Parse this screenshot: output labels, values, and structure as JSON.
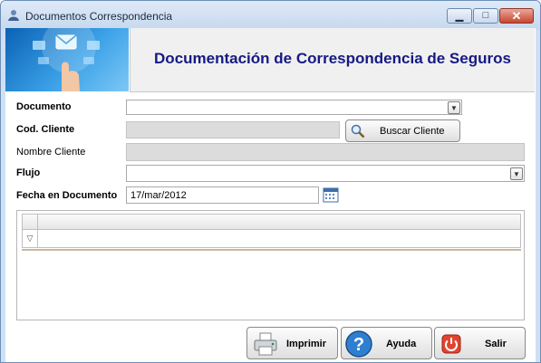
{
  "window": {
    "title": "Documentos Correspondencia",
    "minimize_glyph": "▁",
    "maximize_glyph": "□",
    "close_glyph": "✕"
  },
  "banner": {
    "title": "Documentación de Correspondencia de Seguros",
    "image_icon": "envelope-touch-image"
  },
  "form": {
    "documento": {
      "label": "Documento",
      "value": ""
    },
    "cod_cliente": {
      "label": "Cod. Cliente",
      "value": ""
    },
    "buscar_cliente_button": {
      "label": "Buscar Cliente",
      "icon": "magnifier-icon"
    },
    "nombre_cliente": {
      "label": "Nombre Cliente",
      "value": ""
    },
    "flujo": {
      "label": "Flujo",
      "value": ""
    },
    "fecha_documento": {
      "label": "Fecha en Documento",
      "value": "17/mar/2012",
      "icon": "calendar-icon"
    }
  },
  "grid": {
    "filter_glyph": "▽",
    "rows": []
  },
  "footer": {
    "imprimir": {
      "label": "Imprimir",
      "icon": "printer-icon"
    },
    "ayuda": {
      "label": "Ayuda",
      "icon": "help-icon"
    },
    "salir": {
      "label": "Salir",
      "icon": "power-icon"
    }
  },
  "colors": {
    "banner_title": "#151a84",
    "title_bar": "#cfe0f4",
    "close_button": "#c9452f"
  }
}
